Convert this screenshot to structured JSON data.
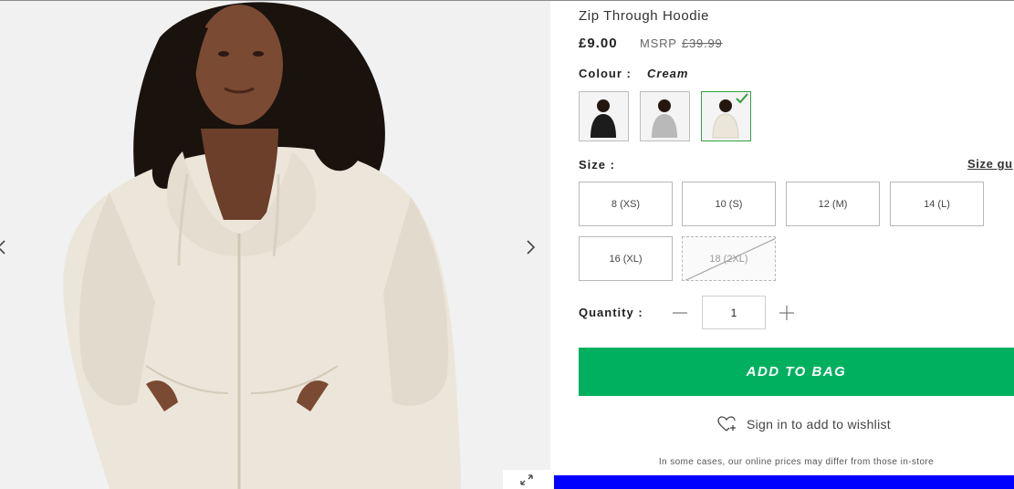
{
  "product": {
    "title": "Zip Through Hoodie",
    "price": "£9.00",
    "msrp_label": "MSRP",
    "msrp_value": "£39.99"
  },
  "colour": {
    "label": "Colour :",
    "selected": "Cream",
    "swatches": [
      {
        "name": "Black",
        "selected": false,
        "color": "#1c1c1c"
      },
      {
        "name": "Grey",
        "selected": false,
        "color": "#b9b9b9"
      },
      {
        "name": "Cream",
        "selected": true,
        "color": "#ece6da"
      }
    ]
  },
  "size": {
    "label": "Size :",
    "guide_label": "Size gu",
    "options": [
      {
        "label": "8 (XS)",
        "available": true
      },
      {
        "label": "10 (S)",
        "available": true
      },
      {
        "label": "12 (M)",
        "available": true
      },
      {
        "label": "14 (L)",
        "available": true
      },
      {
        "label": "16 (XL)",
        "available": true
      },
      {
        "label": "18 (2XL)",
        "available": false
      }
    ]
  },
  "quantity": {
    "label": "Quantity :",
    "value": "1"
  },
  "actions": {
    "add_to_bag": "ADD TO BAG",
    "wishlist": "Sign in to add to wishlist"
  },
  "disclaimer": "In some cases, our online prices may differ from those in-store",
  "icons": {
    "gallery_prev": "chevron-left-icon",
    "gallery_next": "chevron-right-icon",
    "expand": "expand-icon",
    "wishlist": "heart-plus-icon",
    "minus": "minus-icon",
    "plus": "plus-icon",
    "selected": "check-icon"
  },
  "colors": {
    "accent_green": "#00b05f",
    "selected_border": "#2ea043",
    "footer_bar": "#0000ff"
  }
}
